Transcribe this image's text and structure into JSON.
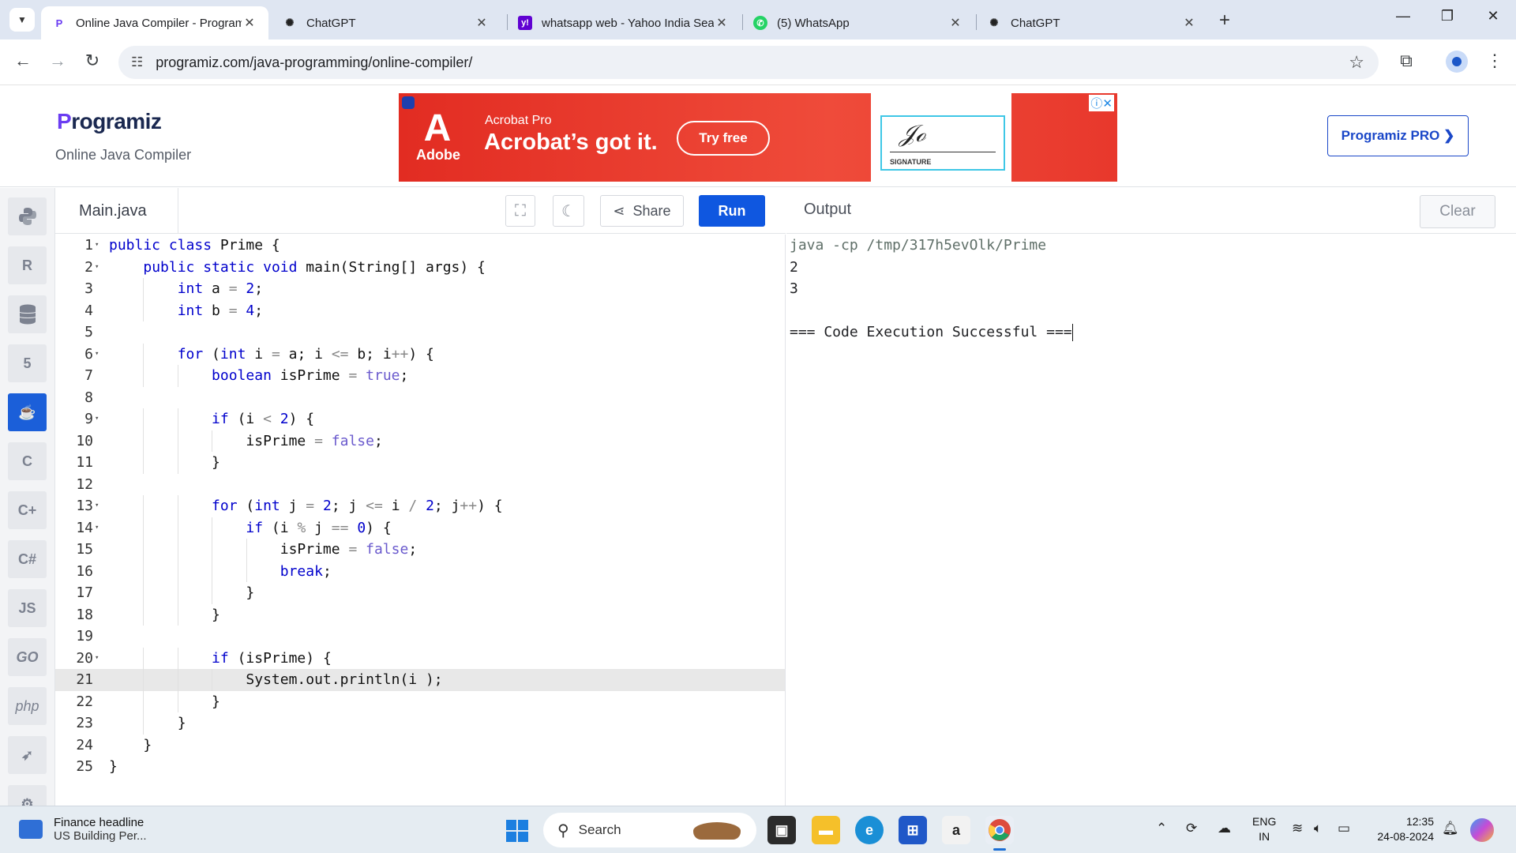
{
  "browser": {
    "tabs": [
      {
        "title": "Online Java Compiler - Programiz",
        "favicon": "programiz-favicon",
        "active": true
      },
      {
        "title": "ChatGPT",
        "favicon": "chatgpt-favicon",
        "active": false
      },
      {
        "title": "whatsapp web - Yahoo India Search",
        "favicon": "yahoo-favicon",
        "active": false
      },
      {
        "title": "(5) WhatsApp",
        "favicon": "whatsapp-favicon",
        "active": false
      },
      {
        "title": "ChatGPT",
        "favicon": "chatgpt-favicon",
        "active": false
      }
    ],
    "url": "programiz.com/java-programming/online-compiler/"
  },
  "header": {
    "logo_mark": "P",
    "logo_text": "rogramiz",
    "subtitle": "Online Java Compiler",
    "pro_button": "Programiz PRO ❯"
  },
  "ad": {
    "brand": "Adobe",
    "product": "Acrobat Pro",
    "headline": "Acrobat’s got it.",
    "cta": "Try free",
    "signature_label": "SIGNATURE"
  },
  "languages": [
    "python",
    "r",
    "sql",
    "html",
    "java",
    "c",
    "cpp",
    "csharp",
    "js",
    "go",
    "php",
    "swift",
    "rust"
  ],
  "language_labels": {
    "js": "JS",
    "go": "GO",
    "php": "php"
  },
  "editor": {
    "file_name": "Main.java",
    "share_label": "Share",
    "run_label": "Run",
    "highlighted_line": 21,
    "lines": [
      "public class Prime {",
      "    public static void main(String[] args) {",
      "        int a = 2;",
      "        int b = 4;",
      "",
      "        for (int i = a; i <= b; i++) {",
      "            boolean isPrime = true;",
      "",
      "            if (i < 2) {",
      "                isPrime = false;",
      "            }",
      "",
      "            for (int j = 2; j <= i / 2; j++) {",
      "                if (i % j == 0) {",
      "                    isPrime = false;",
      "                    break;",
      "                }",
      "            }",
      "",
      "            if (isPrime) {",
      "                System.out.println(i );",
      "            }",
      "        }",
      "    }",
      "}"
    ],
    "fold_lines": [
      1,
      2,
      6,
      9,
      13,
      14,
      20
    ]
  },
  "output": {
    "title": "Output",
    "clear_label": "Clear",
    "command": "java -cp /tmp/317h5evOlk/Prime",
    "lines": [
      "2",
      "3",
      "",
      "=== Code Execution Successful ==="
    ]
  },
  "taskbar": {
    "news_title": "Finance headline",
    "news_sub": "US Building Per...",
    "search_placeholder": "Search",
    "lang_line1": "ENG",
    "lang_line2": "IN",
    "time": "12:35",
    "date": "24-08-2024"
  },
  "colors": {
    "run_button": "#0f57e0",
    "keyword": "#0000cc",
    "number": "#0000cc",
    "literal": "#6a5acd",
    "active_language": "#1b5fd9"
  }
}
